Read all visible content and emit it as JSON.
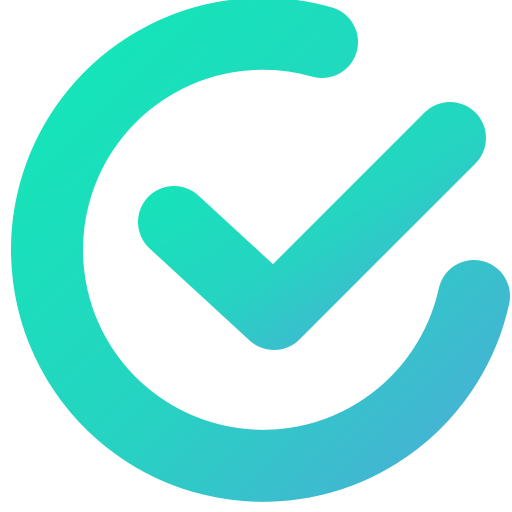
{
  "icon": {
    "name": "check-circle-logo-icon",
    "gradient": {
      "start": "#12E7B7",
      "mid": "#26D3C2",
      "end": "#49AFD6"
    },
    "background": "#FFFFFF"
  }
}
